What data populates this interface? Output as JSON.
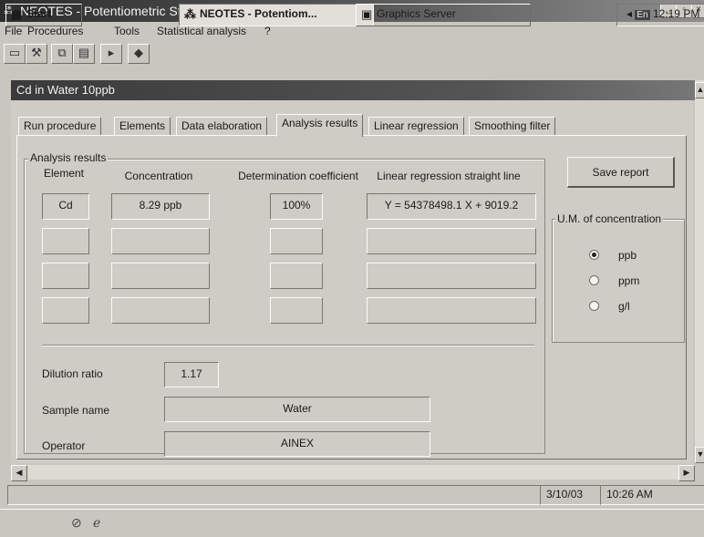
{
  "window": {
    "title": "NEOTES - Potentiometric Stripping Analyzer",
    "icon": "neotes-app-icon"
  },
  "menu": [
    {
      "label": "File"
    },
    {
      "label": "Procedures"
    },
    {
      "label": "Tools"
    },
    {
      "label": "Statistical analysis"
    },
    {
      "label": "?"
    }
  ],
  "toolbar": [
    "open-folder-icon",
    "wrench-icon",
    "copy-icon",
    "paste-icon",
    "run-icon",
    "book-icon"
  ],
  "child": {
    "title": "Cd in Water 10ppb"
  },
  "tabs": [
    {
      "label": "Run procedure",
      "active": false
    },
    {
      "label": "Elements",
      "active": false
    },
    {
      "label": "Data elaboration",
      "active": false
    },
    {
      "label": "Analysis results",
      "active": true
    },
    {
      "label": "Linear regression",
      "active": false
    },
    {
      "label": "Smoothing filter",
      "active": false
    }
  ],
  "results": {
    "group_label": "Analysis results",
    "headers": {
      "element": "Element",
      "concentration": "Concentration",
      "coefficient": "Determination coefficient",
      "regression": "Linear regression straight line"
    },
    "rows": [
      {
        "element": "Cd",
        "concentration": "8.29 ppb",
        "coefficient": "100%",
        "regression": "Y = 54378498.1 X + 9019.2"
      },
      {
        "element": "",
        "concentration": "",
        "coefficient": "",
        "regression": ""
      },
      {
        "element": "",
        "concentration": "",
        "coefficient": "",
        "regression": ""
      },
      {
        "element": "",
        "concentration": "",
        "coefficient": "",
        "regression": ""
      }
    ],
    "dilution": {
      "label": "Dilution ratio",
      "value": "1.17"
    },
    "sample": {
      "label": "Sample name",
      "value": "Water"
    },
    "operator": {
      "label": "Operator",
      "value": "AINEX"
    }
  },
  "save_button": "Save report",
  "units": {
    "group_label": "U.M. of concentration",
    "options": [
      {
        "label": "ppb",
        "checked": true
      },
      {
        "label": "ppm",
        "checked": false
      },
      {
        "label": "g/l",
        "checked": false
      }
    ]
  },
  "statusbar": {
    "date": "3/10/03",
    "time": "10:26 AM"
  },
  "taskbar": {
    "start": "Start",
    "tasks": [
      {
        "label": "NEOTES - Potentiom..."
      },
      {
        "label": "Graphics Server"
      }
    ],
    "tray_lang": "En",
    "clock": "12:19 PM"
  }
}
